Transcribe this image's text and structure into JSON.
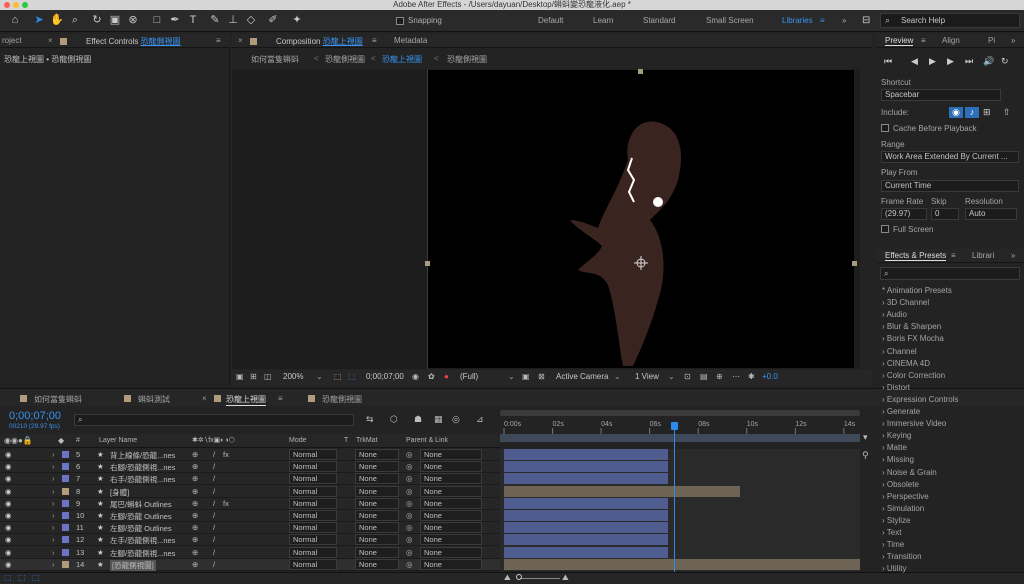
{
  "window": {
    "title": "Adobe After Effects - /Users/dayuan/Desktop/蝌蚪變恐龍液化.aep *"
  },
  "toolbar": {
    "snapping_label": "Snapping"
  },
  "workspaces": {
    "items": [
      "Default",
      "Learn",
      "Standard",
      "Small Screen",
      "Libraries"
    ],
    "active": "Libraries",
    "search_placeholder": "Search Help"
  },
  "project_panel": {
    "tab": "roject"
  },
  "effect_controls": {
    "tab_prefix": "Effect Controls",
    "tab_target": "恐龍側視圖",
    "subtitle": "恐龍上視圖 • 恐龍側視圖"
  },
  "composition": {
    "tab_prefix": "Composition",
    "tab_target": "恐龍上視圖",
    "metadata_tab": "Metadata",
    "breadcrumbs": [
      "如何當隻蝌蚪",
      "恐龍側視圖",
      "恐龍上視圖",
      "恐龍側視圖"
    ],
    "active_breadcrumb": 2,
    "footer": {
      "zoom": "200%",
      "timecode": "0;00;07;00",
      "resolution": "(Full)",
      "camera": "Active Camera",
      "views": "1 View",
      "exposure": "+0.0"
    }
  },
  "preview": {
    "tab": "Preview",
    "tab2": "Align",
    "tab3": "Pi",
    "shortcut_label": "Shortcut",
    "shortcut_value": "Spacebar",
    "include_label": "Include:",
    "cache_label": "Cache Before Playback",
    "range_label": "Range",
    "range_value": "Work Area Extended By Current ...",
    "play_from_label": "Play From",
    "play_from_value": "Current Time",
    "frame_rate_label": "Frame Rate",
    "skip_label": "Skip",
    "resolution_label": "Resolution",
    "frame_rate_value": "(29.97)",
    "skip_value": "0",
    "resolution_value": "Auto",
    "full_screen_label": "Full Screen"
  },
  "effects_presets": {
    "tab": "Effects & Presets",
    "tab2": "Librari",
    "items": [
      "* Animation Presets",
      "3D Channel",
      "Audio",
      "Blur & Sharpen",
      "Boris FX Mocha",
      "Channel",
      "CINEMA 4D",
      "Color Correction",
      "Distort",
      "Expression Controls",
      "Generate",
      "Immersive Video",
      "Keying",
      "Matte",
      "Missing",
      "Noise & Grain",
      "Obsolete",
      "Perspective",
      "Simulation",
      "Stylize",
      "Text",
      "Time",
      "Transition",
      "Utility"
    ]
  },
  "timeline": {
    "tabs": [
      {
        "label": "如何當隻蝌蚪",
        "color": "#b19b7a"
      },
      {
        "label": "蝌蚪測試",
        "color": "#b19b7a"
      },
      {
        "label": "恐龍上視圖",
        "color": "#b19b7a"
      },
      {
        "label": "恐龍側視圖",
        "color": "#b19b7a"
      }
    ],
    "active_tab": 2,
    "timecode": "0;00;07;00",
    "frame_info": "00210 (29.97 fps)",
    "columns": {
      "num": "#",
      "layer_name": "Layer Name",
      "mode": "Mode",
      "t": "T",
      "trkmat": "TrkMat",
      "parent": "Parent & Link"
    },
    "ruler": [
      "0:00s",
      "02s",
      "04s",
      "06s",
      "08s",
      "10s",
      "12s",
      "14s"
    ],
    "playhead_seconds": 7,
    "ruler_seconds_visible": 14.5,
    "layers": [
      {
        "num": "5",
        "name": "背上線條/恐龍...nes",
        "color": "#6c74c8",
        "mode": "Normal",
        "trkmat": "None",
        "parent": "None",
        "fx": true
      },
      {
        "num": "6",
        "name": "右腳/恐龍側視...nes",
        "color": "#6c74c8",
        "mode": "Normal",
        "trkmat": "None",
        "parent": "None",
        "fx": false
      },
      {
        "num": "7",
        "name": "右手/恐龍側視...nes",
        "color": "#6c74c8",
        "mode": "Normal",
        "trkmat": "None",
        "parent": "None",
        "fx": false
      },
      {
        "num": "8",
        "name": "[身體]",
        "color": "#b19b7a",
        "mode": "Normal",
        "trkmat": "None",
        "parent": "None",
        "fx": false
      },
      {
        "num": "9",
        "name": "尾巴/蝌蚪 Outlines",
        "color": "#6c74c8",
        "mode": "Normal",
        "trkmat": "None",
        "parent": "None",
        "fx": true
      },
      {
        "num": "10",
        "name": "左腳/恐龍 Outlines",
        "color": "#6c74c8",
        "mode": "Normal",
        "trkmat": "None",
        "parent": "None",
        "fx": false
      },
      {
        "num": "11",
        "name": "左腳/恐龍 Outlines",
        "color": "#6c74c8",
        "mode": "Normal",
        "trkmat": "None",
        "parent": "None",
        "fx": false
      },
      {
        "num": "12",
        "name": "左手/恐龍側視...nes",
        "color": "#6c74c8",
        "mode": "Normal",
        "trkmat": "None",
        "parent": "None",
        "fx": false
      },
      {
        "num": "13",
        "name": "左腳/恐龍側視...nes",
        "color": "#6c74c8",
        "mode": "Normal",
        "trkmat": "None",
        "parent": "None",
        "fx": false
      },
      {
        "num": "14",
        "name": "[恐龍側視圖]",
        "color": "#b19b7a",
        "mode": "Normal",
        "trkmat": "None",
        "parent": "None",
        "fx": false
      }
    ]
  },
  "colors": {
    "accent": "#2d8ceb",
    "label_blue": "#6c74c8",
    "label_tan": "#b19b7a",
    "dino": "#3a2420",
    "layer_bar_blue": "#4f5c8f",
    "layer_bar_tan": "#6e6456"
  }
}
